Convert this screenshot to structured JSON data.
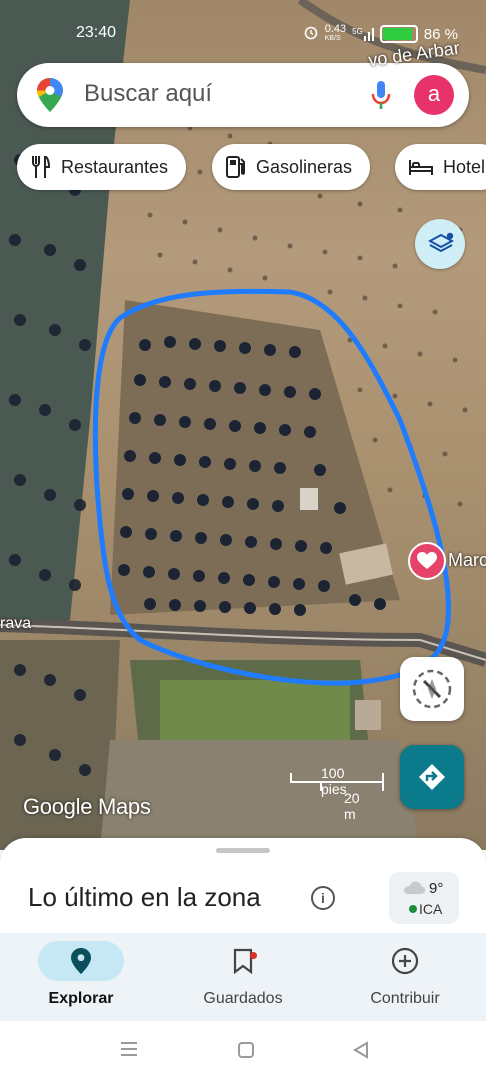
{
  "status_bar": {
    "time": "23:40",
    "net_speed": "0.43",
    "net_unit": "KB/S",
    "net_type": "5G",
    "battery": "86 %",
    "battery_level": 0.86
  },
  "search": {
    "placeholder": "Buscar aquí",
    "avatar_letter": "a"
  },
  "chips": [
    {
      "label": "Restaurantes",
      "icon": "fork-knife-icon"
    },
    {
      "label": "Gasolineras",
      "icon": "gas-pump-icon"
    },
    {
      "label": "Hotel",
      "icon": "bed-icon"
    }
  ],
  "map": {
    "place_label": "Marc",
    "road_label": "rava",
    "road_label_top": "vo de Arbar",
    "scale": {
      "feet": "100 pies",
      "meters": "20 m"
    },
    "logo": "Google Maps"
  },
  "sheet": {
    "title": "Lo último en la zona",
    "weather": {
      "temp": "9°",
      "aq": "ICA"
    }
  },
  "nav": [
    {
      "label": "Explorar",
      "icon": "explore-pin-icon",
      "active": true
    },
    {
      "label": "Guardados",
      "icon": "bookmark-icon",
      "active": false
    },
    {
      "label": "Contribuir",
      "icon": "add-circle-icon",
      "active": false
    }
  ],
  "colors": {
    "accent": "#0b7a8a",
    "highlight_outline": "#1f7cff",
    "avatar": "#e8336a",
    "heart": "#e6436b"
  }
}
